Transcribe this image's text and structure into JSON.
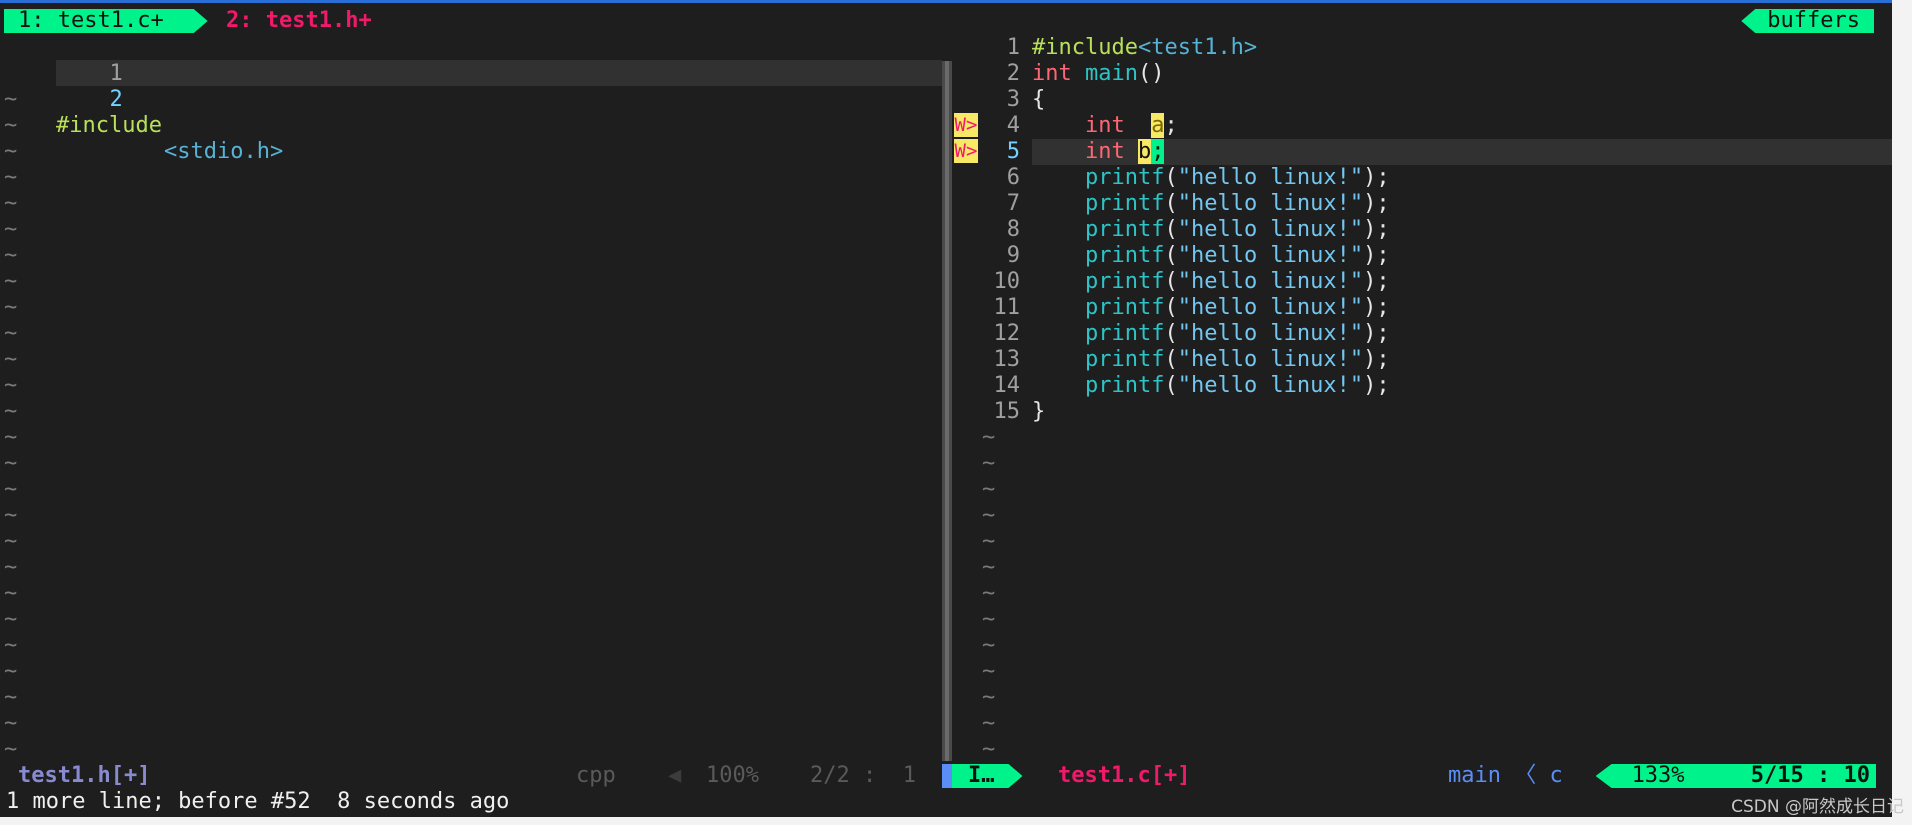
{
  "tabline": {
    "active_tab": "1: test1.c+",
    "inactive_tab": "2: test1.h+",
    "buffers_label": "buffers"
  },
  "left_window": {
    "lines": [
      {
        "num": "1",
        "text": ""
      },
      {
        "num": "2",
        "text_pre": "#include",
        "text_hdr": "<stdio.h>"
      }
    ],
    "tilde_count": 26,
    "tilde_char": "~"
  },
  "right_window": {
    "line_numbers": [
      "1",
      "2",
      "3",
      "4",
      "5",
      "6",
      "7",
      "8",
      "9",
      "10",
      "11",
      "12",
      "13",
      "14",
      "15"
    ],
    "include_kw": "#include",
    "include_hdr": "<test1.h>",
    "main_type": "int",
    "main_name": "main",
    "main_parens": "()",
    "open_brace": "{",
    "close_brace": "}",
    "int_kw": "int",
    "var_a": "a",
    "var_b": "b",
    "semicolon": ";",
    "printf_fn": "printf",
    "printf_open": "(",
    "printf_str": "\"hello linux!\"",
    "printf_close": ");",
    "printf_count": 9,
    "sign_label": "W>",
    "tilde_count": 13,
    "tilde_char": "~"
  },
  "statusline": {
    "left_file": "test1.h[+]",
    "left_filetype": "cpp",
    "left_percent": "100%",
    "left_pos": "2/2 :  1",
    "mode": "I…",
    "right_file": "test1.c[+]",
    "func_path": "main 〈 c",
    "right_percent": "133%",
    "right_pos": "5/15 : 10"
  },
  "cmdline": "1 more line; before #52  8 seconds ago",
  "watermark": "CSDN @阿然成长日记",
  "colors": {
    "accent": "#00f38a",
    "background": "#1e1e1e",
    "sign": "#f7e866",
    "error": "#f0196a"
  }
}
